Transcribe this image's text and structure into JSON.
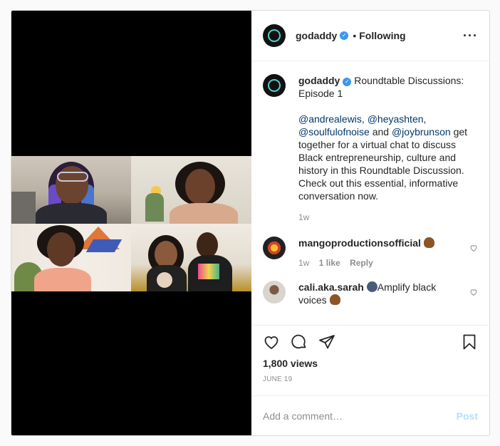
{
  "header": {
    "username": "godaddy",
    "separator": "•",
    "follow_state": "Following",
    "more_icon": "more-options-icon"
  },
  "caption": {
    "username": "godaddy",
    "title": "Roundtable Discussions: Episode 1",
    "mentions": [
      "@andrealewis",
      "@heyashten",
      "@soulfulofnoise",
      "@joybrunson"
    ],
    "separator_1": ",",
    "separator_2": ",",
    "and": "and",
    "text": "get together for a virtual chat to discuss Black entrepreneurship, culture and history in this Roundtable Discussion. Check out this essential, informative conversation now.",
    "time": "1w"
  },
  "comments": [
    {
      "username": "mangoproductionsofficial",
      "time": "1w",
      "likes": "1 like",
      "reply": "Reply",
      "emoji": "raised-fist-icon"
    },
    {
      "username": "cali.aka.sarah",
      "text": "Amplify black voices",
      "emoji": "speaking-head-icon"
    }
  ],
  "actions": {
    "like": "heart-icon",
    "comment": "comment-icon",
    "share": "share-icon",
    "save": "bookmark-icon"
  },
  "views": "1,800 views",
  "date": "JUNE 19",
  "add_comment": {
    "placeholder": "Add a comment…",
    "post": "Post"
  },
  "colors": {
    "accent": "#3897f0",
    "mention": "#00376b",
    "muted": "#8e8e8e",
    "post_disabled": "#b2dffc"
  }
}
